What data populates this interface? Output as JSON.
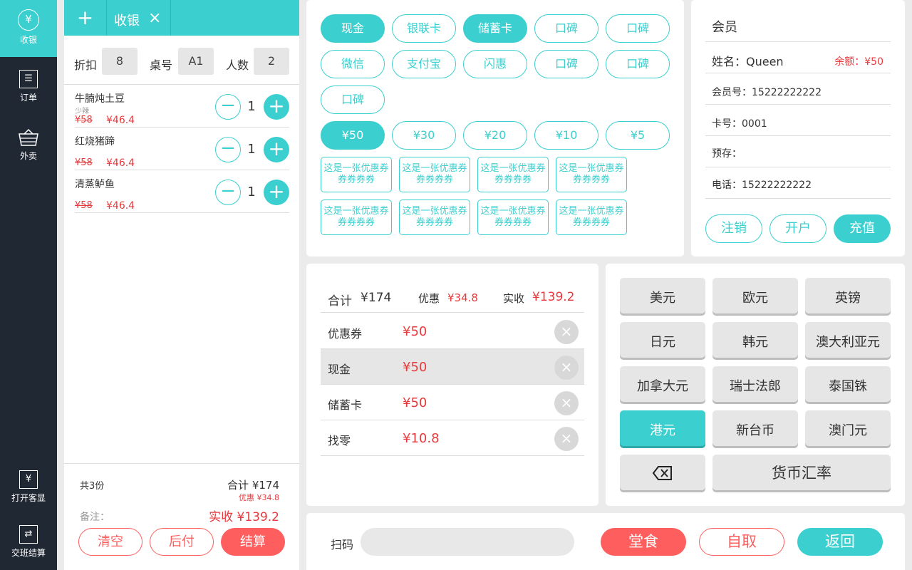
{
  "sidebar": {
    "items": [
      {
        "label": "收银",
        "icon": "yen-circle-icon"
      },
      {
        "label": "订单",
        "icon": "order-list-icon"
      },
      {
        "label": "外卖",
        "icon": "basket-icon"
      }
    ],
    "bottom": [
      {
        "label": "打开客显",
        "icon": "customer-display-icon"
      },
      {
        "label": "交班结算",
        "icon": "shift-exchange-icon"
      }
    ]
  },
  "order": {
    "tab_add": "+",
    "tab_title": "收银",
    "tab_close": "×",
    "discount_label": "折扣",
    "discount_value": "8",
    "table_label": "桌号",
    "table_value": "A1",
    "people_label": "人数",
    "people_value": "2",
    "items": [
      {
        "name": "牛腩炖土豆",
        "note": "少辣",
        "old_price": "¥58",
        "new_price": "¥46.4",
        "qty": "1"
      },
      {
        "name": "红烧猪蹄",
        "note": "",
        "old_price": "¥58",
        "new_price": "¥46.4",
        "qty": "1"
      },
      {
        "name": "清蒸鲈鱼",
        "note": "",
        "old_price": "¥58",
        "new_price": "¥46.4",
        "qty": "1"
      }
    ],
    "count_text": "共3份",
    "total_text": "合计 ¥174",
    "discount_text": "优惠 ¥34.8",
    "remark_label": "备注：",
    "actual_text": "实收 ¥139.2",
    "btn_clear": "清空",
    "btn_later": "后付",
    "btn_settle": "结算"
  },
  "payment_methods": [
    "现金",
    "银联卡",
    "储蓄卡",
    "口碑",
    "口碑",
    "微信",
    "支付宝",
    "闪惠",
    "口碑",
    "口碑",
    "口碑"
  ],
  "payment_methods_selected": [
    "现金",
    "储蓄卡"
  ],
  "amounts": [
    "¥50",
    "¥30",
    "¥20",
    "¥10",
    "¥5"
  ],
  "amount_selected": "¥50",
  "coupons": [
    "这是一张优惠券券券券券",
    "这是一张优惠券券券券券",
    "这是一张优惠券券券券券",
    "这是一张优惠券券券券券",
    "这是一张优惠券券券券券",
    "这是一张优惠券券券券券",
    "这是一张优惠券券券券券",
    "这是一张优惠券券券券券"
  ],
  "summary": {
    "total_label": "合计",
    "total_value": "¥174",
    "discount_label": "优惠",
    "discount_value": "¥34.8",
    "actual_label": "实收",
    "actual_value": "¥139.2",
    "rows": [
      {
        "label": "优惠券",
        "amount": "¥50"
      },
      {
        "label": "现金",
        "amount": "¥50"
      },
      {
        "label": "储蓄卡",
        "amount": "¥50"
      },
      {
        "label": "找零",
        "amount": "¥10.8"
      }
    ],
    "remove_glyph": "×"
  },
  "member": {
    "title": "会员",
    "name_text": "姓名：Queen",
    "balance_text": "余额：¥50",
    "member_no_text": "会员号：15222222222",
    "card_text": "卡号：0001",
    "deposit_text": "预存：",
    "phone_text": "电话：15222222222",
    "btn_cancel": "注销",
    "btn_open": "开户",
    "btn_recharge": "充值"
  },
  "currencies": [
    "美元",
    "欧元",
    "英镑",
    "日元",
    "韩元",
    "澳大利亚元",
    "加拿大元",
    "瑞士法郎",
    "泰国铢",
    "港元",
    "新台币",
    "澳门元"
  ],
  "currency_selected": "港元",
  "exchange_rate_label": "货币汇率",
  "bottom_bar": {
    "scan_label": "扫码",
    "scan_placeholder": "",
    "btn_dine_in": "堂食",
    "btn_pickup": "自取",
    "btn_back": "返回"
  },
  "colors": {
    "accent": "#3bcfcf",
    "red": "#ff5e5e",
    "sidebar": "#202834"
  }
}
